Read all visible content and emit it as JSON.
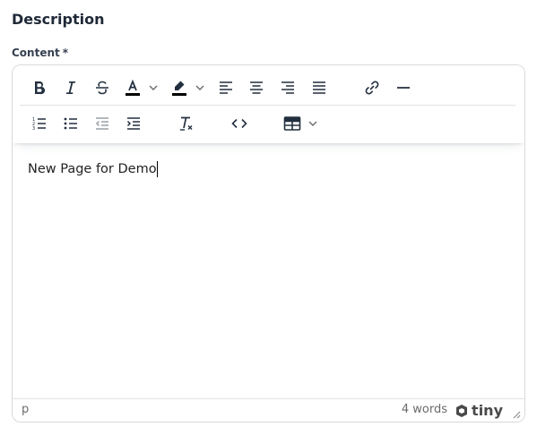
{
  "section": {
    "title": "Description"
  },
  "field": {
    "label": "Content",
    "required_mark": "*"
  },
  "toolbar": {
    "row1": [
      {
        "name": "bold-icon",
        "tooltip": "Bold"
      },
      {
        "name": "italic-icon",
        "tooltip": "Italic"
      },
      {
        "name": "strikethrough-icon",
        "tooltip": "Strikethrough"
      },
      {
        "name": "text-color-icon",
        "tooltip": "Text color",
        "swatch": "#000000"
      },
      {
        "name": "highlight-icon",
        "tooltip": "Background color",
        "swatch": "#000000"
      },
      {
        "name": "align-left-icon",
        "tooltip": "Align left"
      },
      {
        "name": "align-center-icon",
        "tooltip": "Align center"
      },
      {
        "name": "align-right-icon",
        "tooltip": "Align right"
      },
      {
        "name": "justify-icon",
        "tooltip": "Justify"
      },
      {
        "name": "link-icon",
        "tooltip": "Link"
      },
      {
        "name": "horizontal-line-icon",
        "tooltip": "Horizontal line"
      }
    ],
    "row2": [
      {
        "name": "numbered-list-icon",
        "tooltip": "Numbered list"
      },
      {
        "name": "bullet-list-icon",
        "tooltip": "Bullet list"
      },
      {
        "name": "outdent-icon",
        "tooltip": "Decrease indent",
        "disabled": true
      },
      {
        "name": "indent-icon",
        "tooltip": "Increase indent"
      },
      {
        "name": "clear-formatting-icon",
        "tooltip": "Clear formatting"
      },
      {
        "name": "source-code-icon",
        "tooltip": "Source code"
      },
      {
        "name": "table-icon",
        "tooltip": "Table"
      }
    ]
  },
  "editor": {
    "content": "New Page for Demo"
  },
  "statusbar": {
    "path": "p",
    "word_count": "4 words",
    "brand": "tiny"
  },
  "colors": {
    "icon": "#222f3e",
    "disabled_icon": "#9aa0a6",
    "border": "#d9d9d9"
  }
}
